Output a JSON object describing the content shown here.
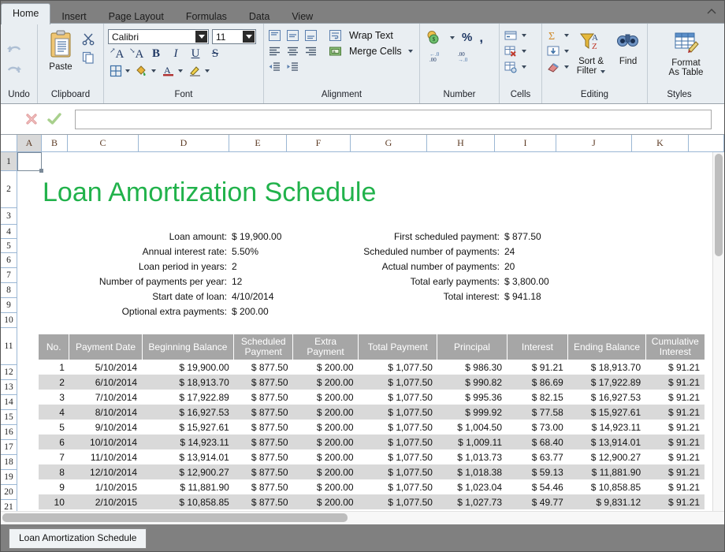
{
  "window": {
    "title": "Loan Amortization Schedule"
  },
  "ribbon": {
    "tabs": [
      {
        "label": "Home",
        "active": true
      },
      {
        "label": "Insert",
        "active": false
      },
      {
        "label": "Page Layout",
        "active": false
      },
      {
        "label": "Formulas",
        "active": false
      },
      {
        "label": "Data",
        "active": false
      },
      {
        "label": "View",
        "active": false
      }
    ],
    "groups": {
      "undo": {
        "label": "Undo",
        "undo_icon": "undo-arrow-icon",
        "redo_icon": "redo-arrow-icon"
      },
      "clipboard": {
        "label": "Clipboard",
        "paste_label": "Paste",
        "cut_icon": "scissors-icon",
        "copy_icon": "copy-icon"
      },
      "font": {
        "label": "Font",
        "font_name": "Calibri",
        "font_size": "11",
        "grow_label": "A",
        "shrink_label": "A",
        "bold_label": "B",
        "italic_label": "I",
        "underline_label": "U",
        "strike_label": "S"
      },
      "alignment": {
        "label": "Alignment",
        "wrap_text_label": "Wrap Text",
        "merge_cells_label": "Merge Cells"
      },
      "number": {
        "label": "Number",
        "percent_label": "%",
        "comma_label": ","
      },
      "cells": {
        "label": "Cells"
      },
      "editing": {
        "label": "Editing",
        "sort_filter_label": "Sort &\nFilter",
        "sort_filter_line1": "Sort &",
        "sort_filter_line2": "Filter",
        "find_label": "Find"
      },
      "styles": {
        "label": "Styles",
        "format_as_table_line1": "Format",
        "format_as_table_line2": "As Table"
      }
    }
  },
  "formula_bar": {
    "cancel_icon": "cancel-x-icon",
    "accept_icon": "accept-check-icon",
    "value": "",
    "placeholder": ""
  },
  "grid": {
    "columns": [
      "A",
      "B",
      "C",
      "D",
      "E",
      "F",
      "G",
      "H",
      "I",
      "J",
      "K"
    ],
    "selected_column": "A",
    "selected_cell": "A1",
    "rows": [
      "1",
      "2",
      "3",
      "4",
      "5",
      "6",
      "7",
      "8",
      "9",
      "10",
      "11",
      "12",
      "13",
      "14",
      "15",
      "16",
      "17",
      "18",
      "19",
      "20",
      "21"
    ],
    "selected_row": "1"
  },
  "sheet": {
    "title": "Loan Amortization Schedule",
    "title_color": "#21b24b",
    "inputs_left": [
      {
        "label": "Loan amount:",
        "value": "$ 19,900.00"
      },
      {
        "label": "Annual interest rate:",
        "value": "5.50%"
      },
      {
        "label": "Loan period in years:",
        "value": "2"
      },
      {
        "label": "Number of payments per year:",
        "value": "12"
      },
      {
        "label": "Start date of loan:",
        "value": "4/10/2014"
      },
      {
        "label": "Optional extra payments:",
        "value": "$ 200.00"
      }
    ],
    "summary_right": [
      {
        "label": "First scheduled payment:",
        "value": "$ 877.50"
      },
      {
        "label": "Scheduled number of payments:",
        "value": "24"
      },
      {
        "label": "Actual number of payments:",
        "value": "20"
      },
      {
        "label": "Total early payments:",
        "value": "$ 3,800.00"
      },
      {
        "label": "Total interest:",
        "value": "$ 941.18"
      }
    ],
    "table": {
      "headers": [
        "No.",
        "Payment Date",
        "Beginning Balance",
        "Scheduled Payment",
        "Extra Payment",
        "Total Payment",
        "Principal",
        "Interest",
        "Ending Balance",
        "Cumulative Interest"
      ],
      "header_bg": "#a6a6a6",
      "header_color": "#ffffff",
      "alt_row_bg": "#d9d9d9",
      "rows": [
        [
          "1",
          "5/10/2014",
          "$ 19,900.00",
          "$ 877.50",
          "$ 200.00",
          "$ 1,077.50",
          "$ 986.30",
          "$ 91.21",
          "$ 18,913.70",
          "$ 91.21"
        ],
        [
          "2",
          "6/10/2014",
          "$ 18,913.70",
          "$ 877.50",
          "$ 200.00",
          "$ 1,077.50",
          "$ 990.82",
          "$ 86.69",
          "$ 17,922.89",
          "$ 91.21"
        ],
        [
          "3",
          "7/10/2014",
          "$ 17,922.89",
          "$ 877.50",
          "$ 200.00",
          "$ 1,077.50",
          "$ 995.36",
          "$ 82.15",
          "$ 16,927.53",
          "$ 91.21"
        ],
        [
          "4",
          "8/10/2014",
          "$ 16,927.53",
          "$ 877.50",
          "$ 200.00",
          "$ 1,077.50",
          "$ 999.92",
          "$ 77.58",
          "$ 15,927.61",
          "$ 91.21"
        ],
        [
          "5",
          "9/10/2014",
          "$ 15,927.61",
          "$ 877.50",
          "$ 200.00",
          "$ 1,077.50",
          "$ 1,004.50",
          "$ 73.00",
          "$ 14,923.11",
          "$ 91.21"
        ],
        [
          "6",
          "10/10/2014",
          "$ 14,923.11",
          "$ 877.50",
          "$ 200.00",
          "$ 1,077.50",
          "$ 1,009.11",
          "$ 68.40",
          "$ 13,914.01",
          "$ 91.21"
        ],
        [
          "7",
          "11/10/2014",
          "$ 13,914.01",
          "$ 877.50",
          "$ 200.00",
          "$ 1,077.50",
          "$ 1,013.73",
          "$ 63.77",
          "$ 12,900.27",
          "$ 91.21"
        ],
        [
          "8",
          "12/10/2014",
          "$ 12,900.27",
          "$ 877.50",
          "$ 200.00",
          "$ 1,077.50",
          "$ 1,018.38",
          "$ 59.13",
          "$ 11,881.90",
          "$ 91.21"
        ],
        [
          "9",
          "1/10/2015",
          "$ 11,881.90",
          "$ 877.50",
          "$ 200.00",
          "$ 1,077.50",
          "$ 1,023.04",
          "$ 54.46",
          "$ 10,858.85",
          "$ 91.21"
        ],
        [
          "10",
          "2/10/2015",
          "$ 10,858.85",
          "$ 877.50",
          "$ 200.00",
          "$ 1,077.50",
          "$ 1,027.73",
          "$ 49.77",
          "$ 9,831.12",
          "$ 91.21"
        ]
      ]
    }
  },
  "sheet_tabs": [
    {
      "label": "Loan Amortization Schedule",
      "active": true
    }
  ]
}
